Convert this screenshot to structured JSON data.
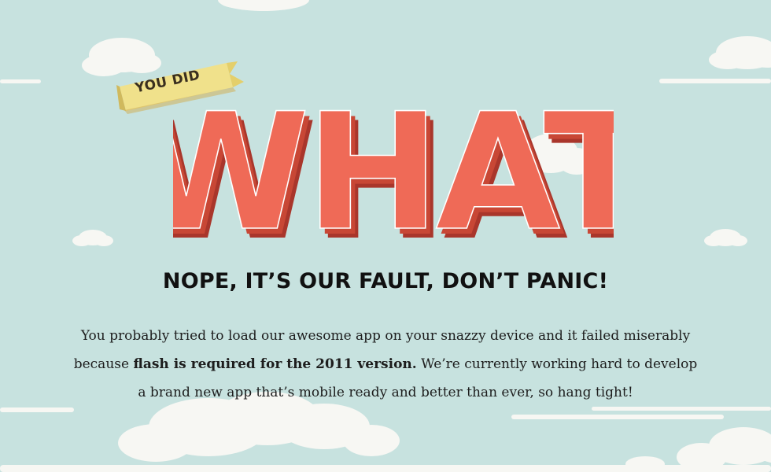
{
  "ribbon": {
    "label": "YOU DID"
  },
  "headline": {
    "word": "WHAT"
  },
  "subtitle": "NOPE, IT’S OUR FAULT, DON’T PANIC!",
  "message": {
    "part1": "You probably tried to load our awesome app on your snazzy device and it failed miserably because ",
    "bold": "flash is required for the 2011 version.",
    "part2": " We’re currently working hard to develop a brand new app that’s mobile ready and better than ever, so hang tight!"
  },
  "colors": {
    "sky": "#c7e2df",
    "cloud": "#f7f7f3",
    "headline_front": "#ef6a57",
    "headline_side": "#c84735",
    "headline_shadow": "#a9362b",
    "ribbon": "#f0e18b",
    "ribbon_shadow": "#d0b95d"
  }
}
